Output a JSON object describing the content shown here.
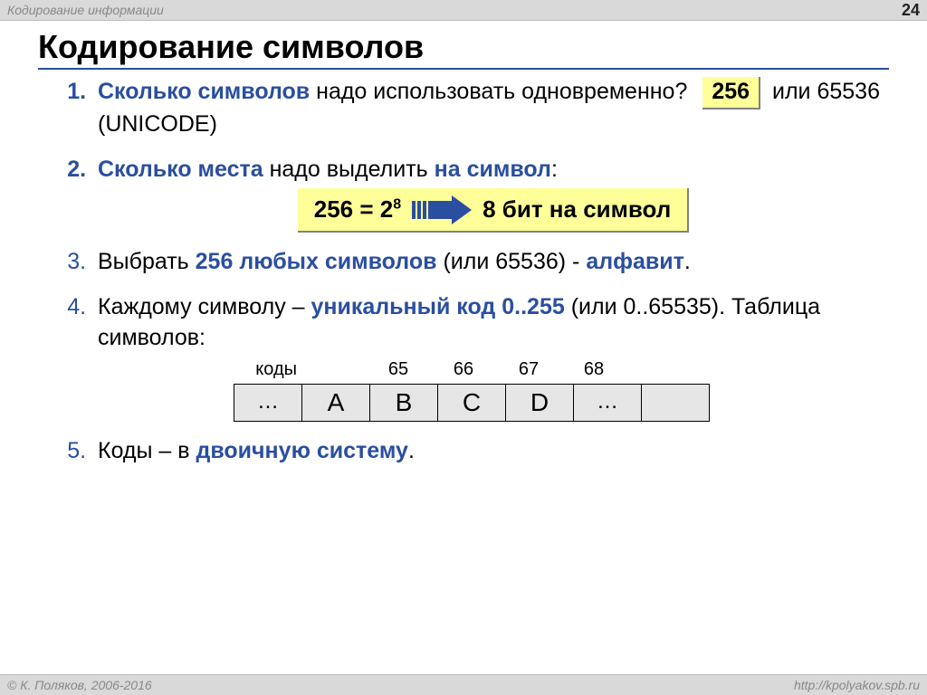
{
  "header": {
    "topic": "Кодирование информации",
    "page": "24"
  },
  "title": "Кодирование символов",
  "items": {
    "one": {
      "lead": "Сколько символов",
      "tail": " надо использовать одновременно?",
      "answer": "256",
      "rest": " или 65536 (UNICODE)"
    },
    "two": {
      "lead": "Сколько места",
      "mid": " надо выделить ",
      "accent": "на символ",
      "colon": ":",
      "formula_left": "256 = 2",
      "formula_exp": "8",
      "formula_right": "8 бит на символ"
    },
    "three": {
      "pre": "Выбрать ",
      "accent1": "256 любых символов",
      "mid": " (или 65536) - ",
      "accent2": "алфавит",
      "post": "."
    },
    "four": {
      "pre": "Каждому символу – ",
      "accent": "уникальный код 0..255",
      "post": " (или 0..65535). Таблица символов:"
    },
    "five": {
      "pre": "Коды – в ",
      "accent": "двоичную систему",
      "post": "."
    }
  },
  "table": {
    "codes_label": "коды",
    "codes": [
      "65",
      "66",
      "67",
      "68"
    ],
    "cells": [
      "…",
      "A",
      "B",
      "C",
      "D",
      "…",
      ""
    ]
  },
  "footer": {
    "copyright": "© К. Поляков, 2006-2016",
    "url": "http://kpolyakov.spb.ru"
  }
}
